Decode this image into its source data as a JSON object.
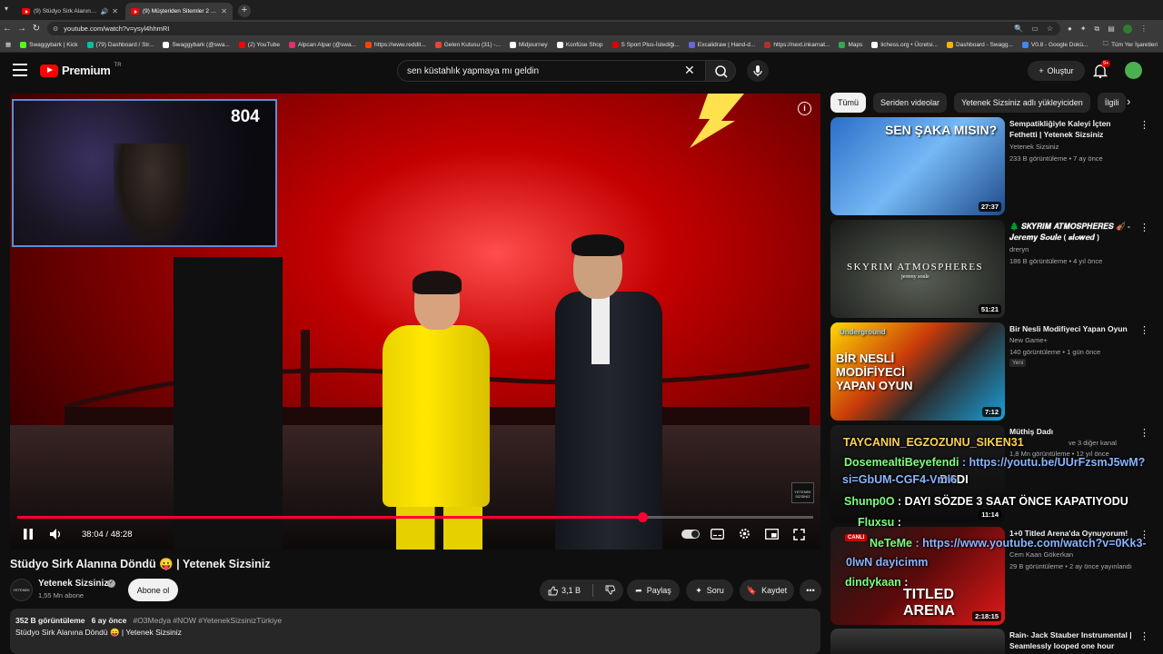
{
  "browser": {
    "tabs": [
      {
        "title": "(9) Stüdyo Sirk Alanına Dö",
        "active": false
      },
      {
        "title": "(9) Müşteriden Sitemler 2 - Yu",
        "active": true
      }
    ],
    "new_tab": "+",
    "url": "youtube.com/watch?v=ysyl4hhmRI",
    "bookmarks": [
      {
        "label": "Swaggybark | Kick",
        "color": "#53fc18"
      },
      {
        "label": "(79) Dashboard / Str...",
        "color": "#00c1a2"
      },
      {
        "label": "Swaggybark (@swa...",
        "color": "#ffffff"
      },
      {
        "label": "(2) YouTube",
        "color": "#ff0000"
      },
      {
        "label": "Alpcan Alpar (@swa...",
        "color": "#e1306c"
      },
      {
        "label": "https://www.reddit...",
        "color": "#ff4500"
      },
      {
        "label": "Gelen Kutusu (31) -...",
        "color": "#ea4335"
      },
      {
        "label": "Midjourney",
        "color": "#ffffff"
      },
      {
        "label": "Konfüse Shop",
        "color": "#ffffff"
      },
      {
        "label": "S Sport Plus-İstediği...",
        "color": "#e00000"
      },
      {
        "label": "Excalidraw | Hand-d...",
        "color": "#6965db"
      },
      {
        "label": "https://next.inkarnat...",
        "color": "#b03030"
      },
      {
        "label": "Maps",
        "color": "#34a853"
      },
      {
        "label": "lichess.org • Ücretsi...",
        "color": "#ffffff"
      },
      {
        "label": "Dashboard - Swagg...",
        "color": "#f4b400"
      },
      {
        "label": "V0.8 - Google Dokü...",
        "color": "#4285f4"
      }
    ],
    "all_bookmarks": "Tüm Yer İşaretleri"
  },
  "header": {
    "logo_text": "Premium",
    "logo_region": "TR",
    "search_query": "sen küstahlık yapmaya mı geldin",
    "create_label": "Oluştur",
    "notif_count": "9+"
  },
  "player": {
    "webcam_counter": "804",
    "time_current": "38:04",
    "time_total": "48:28",
    "progress_fraction": 0.785,
    "watermark": "YETENEK SİZSİNİZ"
  },
  "video": {
    "title": "Stüdyo Sirk Alanına Döndü 😛 | Yetenek Sizsiniz",
    "channel": "Yetenek Sizsiniz",
    "subscribers": "1,55 Mn abone",
    "subscribe_label": "Abone ol",
    "likes": "3,1 B",
    "share_label": "Paylaş",
    "ask_label": "Soru",
    "save_label": "Kaydet",
    "views": "352 B görüntüleme",
    "age": "6 ay önce",
    "hashtags": "#O3Medya #NOW #YetenekSizsinizTürkiye",
    "desc_line": "Stüdyo Sirk Alanına Döndü 😛 | Yetenek Sizsiniz"
  },
  "chips": [
    "Tümü",
    "Seriden videolar",
    "Yetenek Sizsiniz adlı yükleyiciden",
    "İlgili"
  ],
  "recommendations": [
    {
      "title": "Sempatikliğiyle Kaleyi İçten Fethetti | Yetenek Sizsiniz",
      "channel": "Yetenek Sizsiniz",
      "meta": "233 B görüntüleme • 7 ay önce",
      "duration": "27:37",
      "thumb_text": "SEN ŞAKA MISIN?",
      "badge": ""
    },
    {
      "title": "🌲 𝑺𝑲𝒀𝑹𝑰𝑴 𝑨𝑻𝑴𝑶𝑺𝑷𝑯𝑬𝑹𝑬𝑺 🎻 - 𝑱𝒆𝒓𝒆𝒎𝒚 𝑺𝒐𝒖𝒍𝒆 ( 𝒔𝒍𝒐𝒘𝒆𝒅 )",
      "channel": "dreryn",
      "meta": "186 B görüntüleme • 4 yıl önce",
      "duration": "51:21",
      "thumb_text": "SKYRIM ATMOSPHERES",
      "thumb_sub": "jeremy soule",
      "badge": ""
    },
    {
      "title": "Bir Nesli Modifiyeci Yapan Oyun",
      "channel": "New Game+",
      "meta": "140 görüntüleme • 1 gün önce",
      "duration": "7:12",
      "thumb_text": "BİR NESLİ MODİFİYECİ YAPAN OYUN",
      "thumb_sub": "Underground",
      "badge": "Yeni"
    },
    {
      "title": "Müthiş Dadı",
      "channel": "ve 3 diğer kanal",
      "meta": "1,8 Mn görüntüleme • 12 yıl önce",
      "duration": "11:14",
      "thumb_text": "DADI",
      "badge": ""
    },
    {
      "title": "1+0 Titled Arena'da Oynuyorum!",
      "channel": "Cem Kaan Gökerkan",
      "meta": "29 B görüntüleme • 2 ay önce yayınlandı",
      "duration": "2:18:15",
      "thumb_text": "TITLED ARENA",
      "badge": ""
    },
    {
      "title": "Rain- Jack Stauber Instrumental | Seamlessly looped one hour",
      "channel": "",
      "meta": "",
      "duration": "",
      "thumb_text": "",
      "badge": ""
    }
  ],
  "chat": [
    {
      "user": "TAYCANIN_EGZOZUNU_SIKEN31",
      "msg": ""
    },
    {
      "user": "DosemealtiBeyefendi",
      "msg": " : https://youtu.be/UUrFzsmJ5wM?"
    },
    {
      "user": "",
      "msg": "si=GbUM-CGF4-Vml6"
    },
    {
      "user": "Shunp0O",
      "msg": " : DAYI SÖZDE 3 SAAT ÖNCE KAPATIYODU"
    },
    {
      "user": "Fluxsu",
      "msg": " : "
    },
    {
      "user": "NeTeMe",
      "msg": " : https://www.youtube.com/watch?v=0Kk3-"
    },
    {
      "user": "",
      "msg": "0lwN dayicimm"
    },
    {
      "user": "dindykaan",
      "msg": " :"
    }
  ],
  "chat_live_label": "CANLI",
  "colors": {
    "accent": "#ff0033",
    "bg": "#0f0f0f",
    "surface": "#272727",
    "chat_user": "#7dff7d"
  }
}
